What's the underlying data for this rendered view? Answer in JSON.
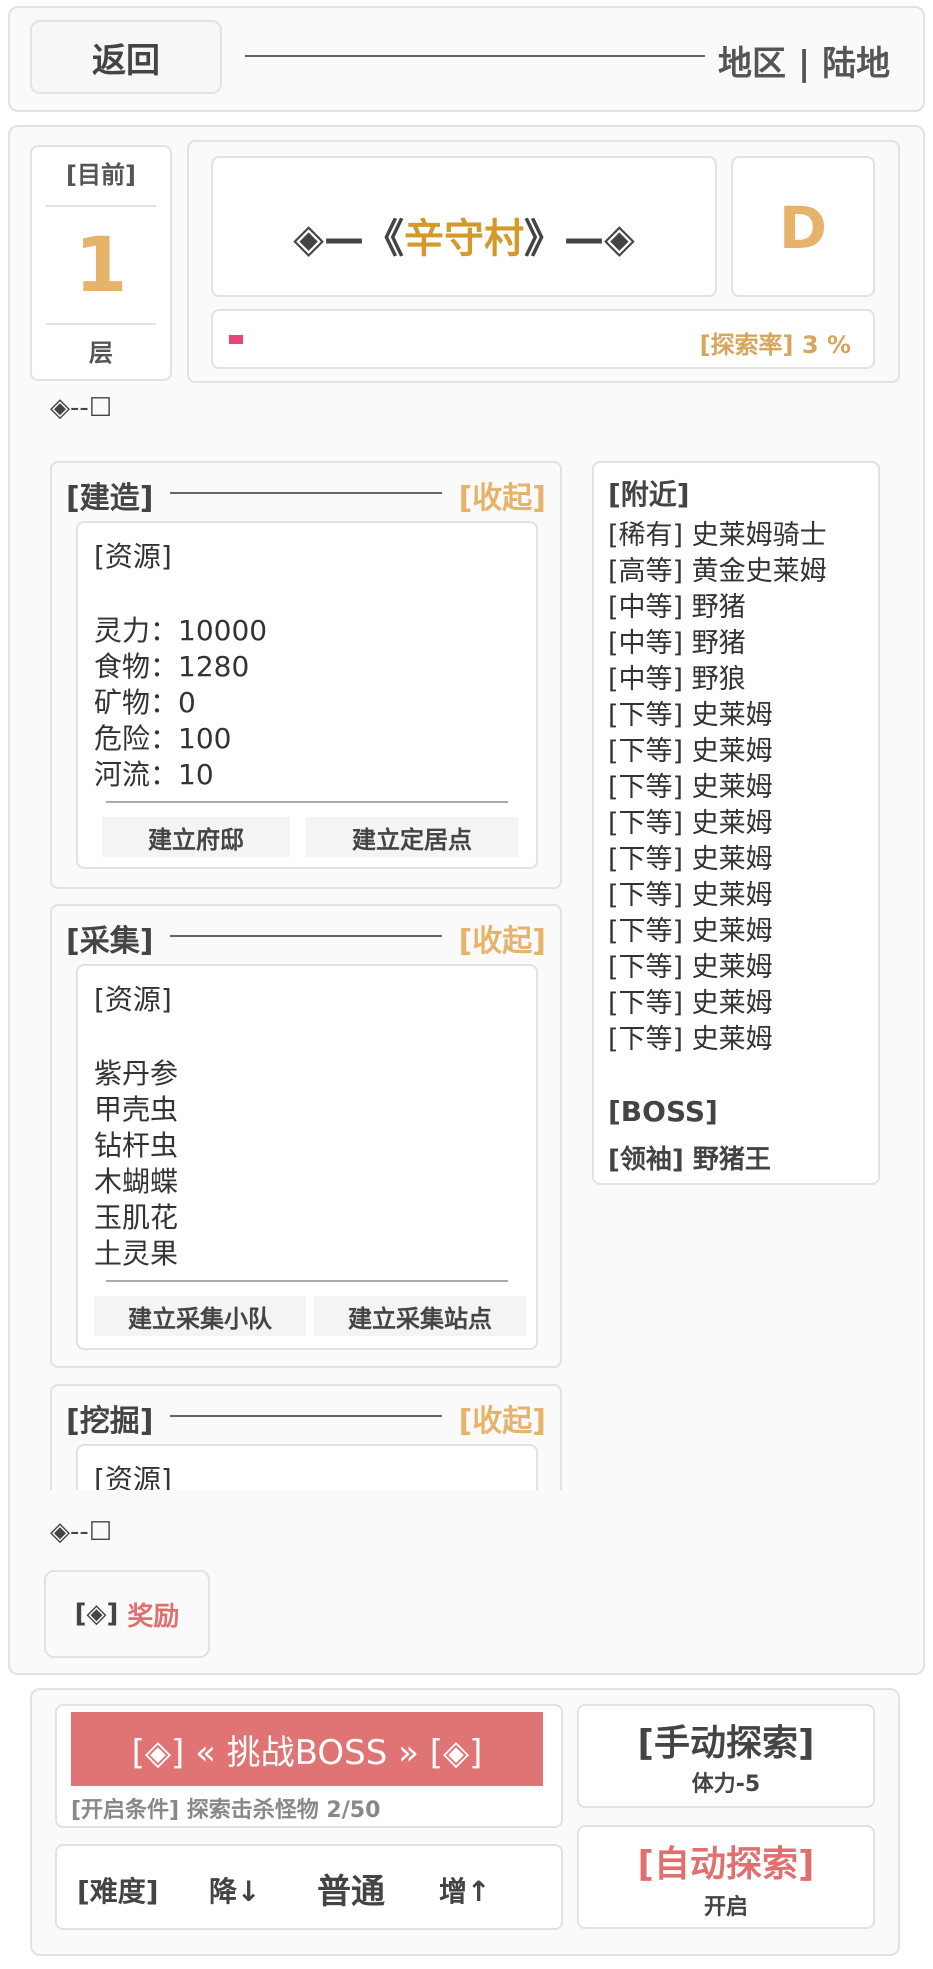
{
  "header": {
    "back_label": "返回",
    "region_label": "地区 | 陆地"
  },
  "floor": {
    "top_label": "[目前]",
    "number": "1",
    "bottom_label": "层"
  },
  "village": {
    "prefix": "◈—《",
    "name": "辛守村",
    "suffix": "》—◈",
    "rank": "D"
  },
  "explore": {
    "label": "[探索率] 3 %",
    "rate_percent": 3
  },
  "ornament": "◈--☐",
  "sections": {
    "build": {
      "title": "[建造]",
      "collapse": "[收起]",
      "resource_title": "[资源]",
      "items": [
        "灵力：10000",
        "食物：1280",
        "矿物：0",
        "危险：100",
        "河流：10"
      ],
      "actions": [
        "建立府邸",
        "建立定居点"
      ]
    },
    "gather": {
      "title": "[采集]",
      "collapse": "[收起]",
      "resource_title": "[资源]",
      "items": [
        "紫丹参",
        "甲壳虫",
        "钻杆虫",
        "木蝴蝶",
        "玉肌花",
        "土灵果"
      ],
      "actions": [
        "建立采集小队",
        "建立采集站点"
      ]
    },
    "dig": {
      "title": "[挖掘]",
      "collapse": "[收起]",
      "resource_title": "[资源]"
    }
  },
  "nearby": {
    "title": "[附近]",
    "items": [
      "[稀有] 史莱姆骑士",
      "[高等] 黄金史莱姆",
      "[中等] 野猪",
      "[中等] 野猪",
      "[中等] 野狼",
      "[下等] 史莱姆",
      "[下等] 史莱姆",
      "[下等] 史莱姆",
      "[下等] 史莱姆",
      "[下等] 史莱姆",
      "[下等] 史莱姆",
      "[下等] 史莱姆",
      "[下等] 史莱姆",
      "[下等] 史莱姆",
      "[下等] 史莱姆"
    ],
    "boss_title": "[BOSS]",
    "boss_item": "[领袖] 野猪王"
  },
  "reward": {
    "prefix": "[◈]",
    "label": "奖励"
  },
  "boss": {
    "button_label": "[◈] « 挑战BOSS » [◈]",
    "condition": "[开启条件] 探索击杀怪物 2/50"
  },
  "difficulty": {
    "label": "[难度]",
    "down": "降↓",
    "value": "普通",
    "up": "增↑"
  },
  "manual": {
    "title": "[手动探索]",
    "sub": "体力-5"
  },
  "auto": {
    "title": "[自动探索]",
    "sub": "开启"
  },
  "colors": {
    "accent_gold": "#d39a2a",
    "light_gold": "#e6b36b",
    "boss_red": "#e07373",
    "progress_pink": "#e8467a"
  }
}
